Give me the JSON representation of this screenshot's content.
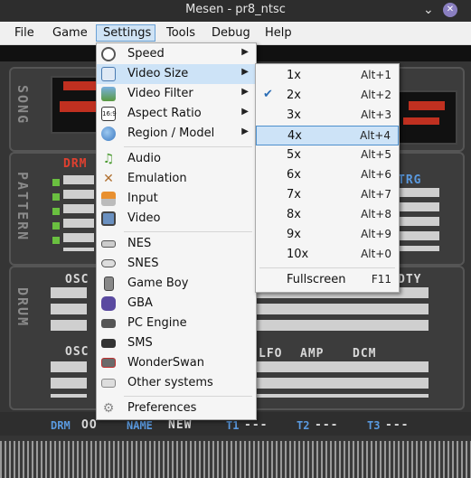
{
  "window": {
    "title": "Mesen - pr8_ntsc",
    "minimize": "⌄",
    "close": "✕"
  },
  "menubar": [
    "File",
    "Game",
    "Settings",
    "Tools",
    "Debug",
    "Help"
  ],
  "settings_menu": [
    {
      "label": "Speed",
      "icon": "speed-icon",
      "submenu": true
    },
    {
      "label": "Video Size",
      "icon": "video-size-icon",
      "submenu": true
    },
    {
      "label": "Video Filter",
      "icon": "video-filter-icon",
      "submenu": true
    },
    {
      "label": "Aspect Ratio",
      "icon": "aspect-ratio-icon",
      "submenu": true
    },
    {
      "label": "Region / Model",
      "icon": "globe-icon",
      "submenu": true
    },
    {
      "label": "Audio",
      "icon": "audio-icon"
    },
    {
      "label": "Emulation",
      "icon": "emulation-icon"
    },
    {
      "label": "Input",
      "icon": "input-icon"
    },
    {
      "label": "Video",
      "icon": "video-icon"
    },
    {
      "label": "NES",
      "icon": "nes-icon"
    },
    {
      "label": "SNES",
      "icon": "snes-icon"
    },
    {
      "label": "Game Boy",
      "icon": "gameboy-icon"
    },
    {
      "label": "GBA",
      "icon": "gba-icon"
    },
    {
      "label": "PC Engine",
      "icon": "pc-engine-icon"
    },
    {
      "label": "SMS",
      "icon": "sms-icon"
    },
    {
      "label": "WonderSwan",
      "icon": "wonderswan-icon"
    },
    {
      "label": "Other systems",
      "icon": "other-systems-icon"
    },
    {
      "label": "Preferences",
      "icon": "gear-icon"
    }
  ],
  "video_size_menu": [
    {
      "label": "1x",
      "shortcut": "Alt+1"
    },
    {
      "label": "2x",
      "shortcut": "Alt+2",
      "checked": true
    },
    {
      "label": "3x",
      "shortcut": "Alt+3"
    },
    {
      "label": "4x",
      "shortcut": "Alt+4"
    },
    {
      "label": "5x",
      "shortcut": "Alt+5"
    },
    {
      "label": "6x",
      "shortcut": "Alt+6"
    },
    {
      "label": "7x",
      "shortcut": "Alt+7"
    },
    {
      "label": "8x",
      "shortcut": "Alt+8"
    },
    {
      "label": "9x",
      "shortcut": "Alt+9"
    },
    {
      "label": "10x",
      "shortcut": "Alt+0"
    },
    {
      "label": "Fullscreen",
      "shortcut": "F11"
    }
  ],
  "game": {
    "side_song": "SONG",
    "side_pattern": "PATTERN",
    "side_drum": "DRUM",
    "drm": "DRM",
    "trg": "TRG",
    "osc1": "OSC",
    "osc2": "OSC",
    "dty": "DTY",
    "lfo": "LFO",
    "amp": "AMP",
    "dcm": "DCM",
    "footer": [
      "DRM",
      "OO",
      "NAME",
      "NEW",
      "T1",
      "---",
      "T2",
      "---",
      "T3",
      "---"
    ]
  }
}
